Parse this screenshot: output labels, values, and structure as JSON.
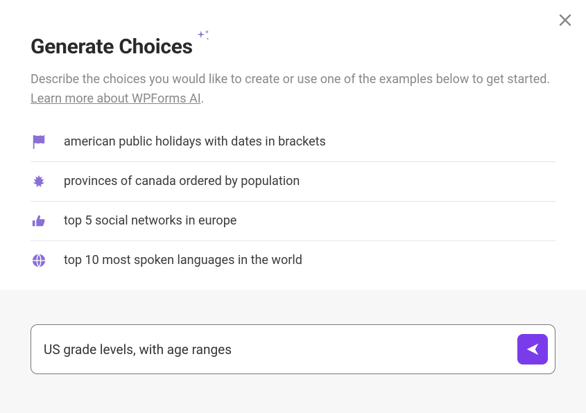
{
  "header": {
    "title": "Generate Choices"
  },
  "description": {
    "text": "Describe the choices you would like to create or use one of the examples below to get started. ",
    "link_text": "Learn more about WPForms AI",
    "period": "."
  },
  "examples": [
    {
      "icon": "flag-icon",
      "label": "american public holidays with dates in brackets"
    },
    {
      "icon": "leaf-icon",
      "label": "provinces of canada ordered by population"
    },
    {
      "icon": "thumbs-up-icon",
      "label": "top 5 social networks in europe"
    },
    {
      "icon": "globe-icon",
      "label": "top 10 most spoken languages in the world"
    }
  ],
  "input": {
    "value": "US grade levels, with age ranges",
    "placeholder": ""
  },
  "colors": {
    "accent": "#7a3bea",
    "icon_purple": "#8a6fd6"
  }
}
